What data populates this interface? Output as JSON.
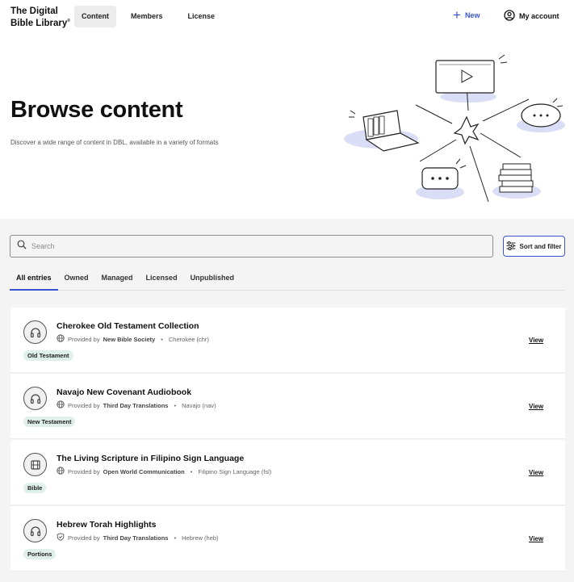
{
  "header": {
    "logo_line1": "The Digital",
    "logo_line2": "Bible Library",
    "logo_mark": "®",
    "nav": [
      {
        "label": "Content",
        "active": true
      },
      {
        "label": "Members",
        "active": false
      },
      {
        "label": "License",
        "active": false
      }
    ],
    "new_label": "New",
    "account_label": "My account"
  },
  "hero": {
    "title": "Browse content",
    "description": "Discover a wide range of content in DBL, available in a variety of formats"
  },
  "search": {
    "placeholder": "Search",
    "value": "",
    "filter_label": "Sort and filter"
  },
  "tabs": [
    {
      "label": "All entries",
      "active": true
    },
    {
      "label": "Owned",
      "active": false
    },
    {
      "label": "Managed",
      "active": false
    },
    {
      "label": "Licensed",
      "active": false
    },
    {
      "label": "Unpublished",
      "active": false
    }
  ],
  "entries": [
    {
      "icon": "headphones-icon",
      "title": "Cherokee Old Testament Collection",
      "meta_icon": "globe-icon",
      "provided_by_prefix": "Provided by",
      "provider": "New Bible Society",
      "language": "Cherokee (chr)",
      "badge": "Old Testament",
      "view_label": "View"
    },
    {
      "icon": "headphones-icon",
      "title": "Navajo New Covenant Audiobook",
      "meta_icon": "globe-icon",
      "provided_by_prefix": "Provided by",
      "provider": "Third Day Translations",
      "language": "Navajo (nav)",
      "badge": "New Testament",
      "view_label": "View"
    },
    {
      "icon": "film-icon",
      "title": "The Living Scripture in Filipino Sign Language",
      "meta_icon": "globe-icon",
      "provided_by_prefix": "Provided by",
      "provider": "Open World Communication",
      "language": "Filipino Sign Language (fsl)",
      "badge": "Bible",
      "view_label": "View"
    },
    {
      "icon": "headphones-icon",
      "title": "Hebrew Torah Highlights",
      "meta_icon": "shield-icon",
      "provided_by_prefix": "Provided by",
      "provider": "Third Day Translations",
      "language": "Hebrew (heb)",
      "badge": "Portions",
      "view_label": "View"
    }
  ],
  "colors": {
    "accent": "#3a55d4",
    "badge_bg": "#dff0eb",
    "content_bg": "#f4f4f4"
  }
}
